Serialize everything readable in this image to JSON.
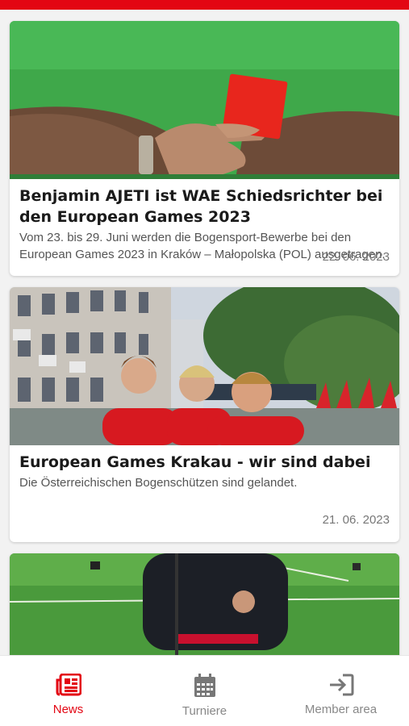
{
  "articles": [
    {
      "title": "Benjamin AJETI ist WAE Schiedsrichter bei den European Games 2023",
      "description": "Vom 23. bis 29. Juni werden die Bogensport-Bewerbe bei den European Games 2023 in Kraków – Małopolska (POL) ausgetragen.",
      "date": "22. 06. 2023"
    },
    {
      "title": "European Games Krakau - wir sind dabei",
      "description": "Die Österreichischen Bogenschützen sind gelandet.",
      "date": "21. 06. 2023"
    }
  ],
  "nav": {
    "items": [
      {
        "label": "News",
        "icon": "newspaper-icon",
        "active": true
      },
      {
        "label": "Turniere",
        "icon": "calendar-icon",
        "active": false
      },
      {
        "label": "Member area",
        "icon": "sign-in-icon",
        "active": false
      }
    ]
  },
  "colors": {
    "accent": "#e30613",
    "inactive": "#888888"
  }
}
